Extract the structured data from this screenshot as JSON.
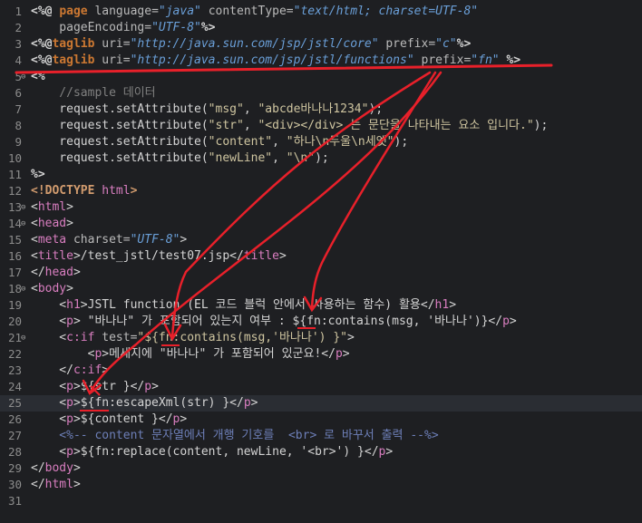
{
  "editor": {
    "current_line": 25,
    "lines": [
      {
        "n": "1",
        "fold": "",
        "tokens": [
          {
            "t": "<%@ ",
            "c": "dir"
          },
          {
            "t": "page ",
            "c": "kw"
          },
          {
            "t": "language=",
            "c": "attr"
          },
          {
            "t": "\"java\"",
            "c": "str"
          },
          {
            "t": " contentType=",
            "c": "attr"
          },
          {
            "t": "\"text/html; charset=UTF-8\"",
            "c": "str"
          }
        ]
      },
      {
        "n": "2",
        "fold": "",
        "tokens": [
          {
            "t": "    pageEncoding=",
            "c": "attr"
          },
          {
            "t": "\"UTF-8\"",
            "c": "str"
          },
          {
            "t": "%>",
            "c": "dir"
          }
        ]
      },
      {
        "n": "3",
        "fold": "",
        "tokens": [
          {
            "t": "<%@",
            "c": "dir"
          },
          {
            "t": "taglib ",
            "c": "kw"
          },
          {
            "t": "uri=",
            "c": "attr"
          },
          {
            "t": "\"http://java.sun.com/jsp/jstl/core\"",
            "c": "str"
          },
          {
            "t": " prefix=",
            "c": "attr"
          },
          {
            "t": "\"c\"",
            "c": "str"
          },
          {
            "t": "%>",
            "c": "dir"
          }
        ]
      },
      {
        "n": "4",
        "fold": "",
        "tokens": [
          {
            "t": "<%@",
            "c": "dir"
          },
          {
            "t": "taglib ",
            "c": "kw"
          },
          {
            "t": "uri=",
            "c": "attr"
          },
          {
            "t": "\"http://java.sun.com/jsp/jstl/functions\"",
            "c": "str"
          },
          {
            "t": " prefix=",
            "c": "attr"
          },
          {
            "t": "\"fn\"",
            "c": "str"
          },
          {
            "t": " %>",
            "c": "dir"
          }
        ]
      },
      {
        "n": "5",
        "fold": "⊖",
        "tokens": [
          {
            "t": "<%",
            "c": "dir"
          }
        ]
      },
      {
        "n": "6",
        "fold": "",
        "tokens": [
          {
            "t": "    //sample 데이터",
            "c": "cmt"
          }
        ]
      },
      {
        "n": "7",
        "fold": "",
        "tokens": [
          {
            "t": "    request.setAttribute(",
            "c": "pln"
          },
          {
            "t": "\"msg\"",
            "c": "str2"
          },
          {
            "t": ", ",
            "c": "pln"
          },
          {
            "t": "\"abcde바나나1234\"",
            "c": "str2"
          },
          {
            "t": ");",
            "c": "pln"
          }
        ]
      },
      {
        "n": "8",
        "fold": "",
        "tokens": [
          {
            "t": "    request.setAttribute(",
            "c": "pln"
          },
          {
            "t": "\"str\"",
            "c": "str2"
          },
          {
            "t": ", ",
            "c": "pln"
          },
          {
            "t": "\"<div></div> 는 문단을 나타내는 요소 입니다.\"",
            "c": "str2"
          },
          {
            "t": ");",
            "c": "pln"
          }
        ]
      },
      {
        "n": "9",
        "fold": "",
        "tokens": [
          {
            "t": "    request.setAttribute(",
            "c": "pln"
          },
          {
            "t": "\"content\"",
            "c": "str2"
          },
          {
            "t": ", ",
            "c": "pln"
          },
          {
            "t": "\"하나\\n두울\\n세엣\"",
            "c": "str2"
          },
          {
            "t": ");",
            "c": "pln"
          }
        ]
      },
      {
        "n": "10",
        "fold": "",
        "tokens": [
          {
            "t": "    request.setAttribute(",
            "c": "pln"
          },
          {
            "t": "\"newLine\"",
            "c": "str2"
          },
          {
            "t": ", ",
            "c": "pln"
          },
          {
            "t": "\"\\n\"",
            "c": "str2"
          },
          {
            "t": ");",
            "c": "pln"
          }
        ]
      },
      {
        "n": "11",
        "fold": "",
        "tokens": [
          {
            "t": "%>",
            "c": "dir"
          }
        ]
      },
      {
        "n": "12",
        "fold": "",
        "tokens": [
          {
            "t": "<!DOCTYPE ",
            "c": "doc"
          },
          {
            "t": "html",
            "c": "tag"
          },
          {
            "t": ">",
            "c": "doc"
          }
        ]
      },
      {
        "n": "13",
        "fold": "⊖",
        "tokens": [
          {
            "t": "<",
            "c": "pln"
          },
          {
            "t": "html",
            "c": "tag"
          },
          {
            "t": ">",
            "c": "pln"
          }
        ]
      },
      {
        "n": "14",
        "fold": "⊖",
        "tokens": [
          {
            "t": "<",
            "c": "pln"
          },
          {
            "t": "head",
            "c": "tag"
          },
          {
            "t": ">",
            "c": "pln"
          }
        ]
      },
      {
        "n": "15",
        "fold": "",
        "tokens": [
          {
            "t": "<",
            "c": "pln"
          },
          {
            "t": "meta ",
            "c": "tag"
          },
          {
            "t": "charset=",
            "c": "attr"
          },
          {
            "t": "\"UTF-8\"",
            "c": "str"
          },
          {
            "t": ">",
            "c": "pln"
          }
        ]
      },
      {
        "n": "16",
        "fold": "",
        "tokens": [
          {
            "t": "<",
            "c": "pln"
          },
          {
            "t": "title",
            "c": "tag"
          },
          {
            "t": ">/test_jstl/test07.jsp</",
            "c": "pln"
          },
          {
            "t": "title",
            "c": "tag"
          },
          {
            "t": ">",
            "c": "pln"
          }
        ]
      },
      {
        "n": "17",
        "fold": "",
        "tokens": [
          {
            "t": "</",
            "c": "pln"
          },
          {
            "t": "head",
            "c": "tag"
          },
          {
            "t": ">",
            "c": "pln"
          }
        ]
      },
      {
        "n": "18",
        "fold": "⊖",
        "tokens": [
          {
            "t": "<",
            "c": "pln"
          },
          {
            "t": "body",
            "c": "tag"
          },
          {
            "t": ">",
            "c": "pln"
          }
        ]
      },
      {
        "n": "19",
        "fold": "",
        "tokens": [
          {
            "t": "    <",
            "c": "pln"
          },
          {
            "t": "h1",
            "c": "tag"
          },
          {
            "t": ">JSTL function (EL 코드 블럭 안에서 사용하는 함수) 활용</",
            "c": "pln"
          },
          {
            "t": "h1",
            "c": "tag"
          },
          {
            "t": ">",
            "c": "pln"
          }
        ]
      },
      {
        "n": "20",
        "fold": "",
        "tokens": [
          {
            "t": "    <",
            "c": "pln"
          },
          {
            "t": "p",
            "c": "tag"
          },
          {
            "t": "> \"바나나\" 가 포함되어 있는지 여부 : ${fn:contains(msg, '바나나')}</",
            "c": "pln"
          },
          {
            "t": "p",
            "c": "tag"
          },
          {
            "t": ">",
            "c": "pln"
          }
        ]
      },
      {
        "n": "21",
        "fold": "⊖",
        "tokens": [
          {
            "t": "    <",
            "c": "pln"
          },
          {
            "t": "c:if ",
            "c": "tag"
          },
          {
            "t": "test=",
            "c": "attr"
          },
          {
            "t": "\"${fn:contains(msg,'바나나') }\"",
            "c": "str2"
          },
          {
            "t": ">",
            "c": "pln"
          }
        ]
      },
      {
        "n": "22",
        "fold": "",
        "tokens": [
          {
            "t": "        <",
            "c": "pln"
          },
          {
            "t": "p",
            "c": "tag"
          },
          {
            "t": ">메세지에 \"바나나\" 가 포함되어 있군요!</",
            "c": "pln"
          },
          {
            "t": "p",
            "c": "tag"
          },
          {
            "t": ">",
            "c": "pln"
          }
        ]
      },
      {
        "n": "23",
        "fold": "",
        "tokens": [
          {
            "t": "    </",
            "c": "pln"
          },
          {
            "t": "c:if",
            "c": "tag"
          },
          {
            "t": ">",
            "c": "pln"
          }
        ]
      },
      {
        "n": "24",
        "fold": "",
        "tokens": [
          {
            "t": "    <",
            "c": "pln"
          },
          {
            "t": "p",
            "c": "tag"
          },
          {
            "t": ">${str }</",
            "c": "pln"
          },
          {
            "t": "p",
            "c": "tag"
          },
          {
            "t": ">",
            "c": "pln"
          }
        ]
      },
      {
        "n": "25",
        "fold": "",
        "tokens": [
          {
            "t": "    <",
            "c": "pln"
          },
          {
            "t": "p",
            "c": "tag"
          },
          {
            "t": ">${fn:escapeXml(str) }</",
            "c": "pln"
          },
          {
            "t": "p",
            "c": "tag"
          },
          {
            "t": ">",
            "c": "pln"
          }
        ]
      },
      {
        "n": "26",
        "fold": "",
        "tokens": [
          {
            "t": "    <",
            "c": "pln"
          },
          {
            "t": "p",
            "c": "tag"
          },
          {
            "t": ">${content }</",
            "c": "pln"
          },
          {
            "t": "p",
            "c": "tag"
          },
          {
            "t": ">",
            "c": "pln"
          }
        ]
      },
      {
        "n": "27",
        "fold": "",
        "tokens": [
          {
            "t": "    <%-- content 문자열에서 개행 기호를  <br> 로 바꾸서 출력 --%>",
            "c": "cmt2"
          }
        ]
      },
      {
        "n": "28",
        "fold": "",
        "tokens": [
          {
            "t": "    <",
            "c": "pln"
          },
          {
            "t": "p",
            "c": "tag"
          },
          {
            "t": ">${fn:replace(content, newLine, '<br>') }</",
            "c": "pln"
          },
          {
            "t": "p",
            "c": "tag"
          },
          {
            "t": ">",
            "c": "pln"
          }
        ]
      },
      {
        "n": "29",
        "fold": "",
        "tokens": [
          {
            "t": "</",
            "c": "pln"
          },
          {
            "t": "body",
            "c": "tag"
          },
          {
            "t": ">",
            "c": "pln"
          }
        ]
      },
      {
        "n": "30",
        "fold": "",
        "tokens": [
          {
            "t": "</",
            "c": "pln"
          },
          {
            "t": "html",
            "c": "tag"
          },
          {
            "t": ">",
            "c": "pln"
          }
        ]
      },
      {
        "n": "31",
        "fold": "",
        "tokens": []
      }
    ]
  },
  "annotation": {
    "color": "#e8202a"
  }
}
